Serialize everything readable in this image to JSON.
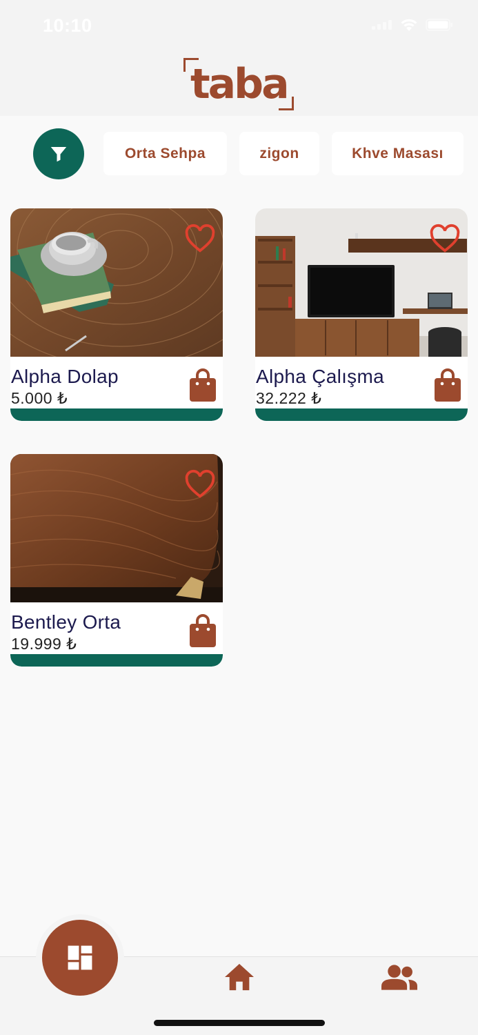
{
  "status_bar": {
    "time": "10:10",
    "icons": [
      "signal-icon",
      "wifi-icon",
      "battery-icon"
    ]
  },
  "header": {
    "logo_text": "taba"
  },
  "filters": {
    "filter_icon": "filter-icon",
    "chips": [
      {
        "label": "Orta Sehpa"
      },
      {
        "label": "zigon"
      },
      {
        "label": "Khve Masası"
      }
    ]
  },
  "products": [
    {
      "name": "Alpha Dolap",
      "price": "5.000 ₺"
    },
    {
      "name": "Alpha Çalışma",
      "price": "32.222 ₺"
    },
    {
      "name": "Bentley Orta",
      "price": "19.999 ₺"
    }
  ],
  "bottom_nav": {
    "items": [
      "dashboard-icon",
      "home-icon",
      "people-icon"
    ]
  },
  "colors": {
    "brand": "#9c4a2e",
    "accent": "#0d6657",
    "heart": "#e0402e",
    "text": "#1c1a4e"
  }
}
